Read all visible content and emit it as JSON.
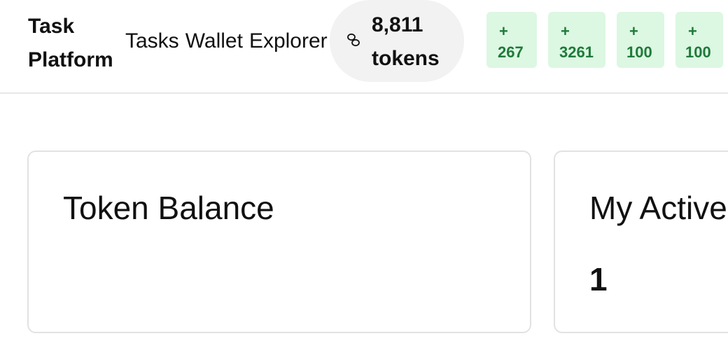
{
  "header": {
    "brand": "Task Platform",
    "nav": [
      "Tasks",
      "Wallet",
      "Explorer"
    ],
    "balance": {
      "amount": "8,811 tokens",
      "icon": "coins-icon"
    },
    "activity_chips": [
      {
        "sign": "+",
        "value": "267"
      },
      {
        "sign": "+",
        "value": "3261"
      },
      {
        "sign": "+",
        "value": "100"
      },
      {
        "sign": "+",
        "value": "100"
      }
    ]
  },
  "cards": [
    {
      "title": "Token Balance",
      "value": ""
    },
    {
      "title": "My Active",
      "value": "1"
    }
  ],
  "colors": {
    "chip_bg": "#dcf7e2",
    "chip_text": "#1f7a3a",
    "pill_bg": "#f2f2f2",
    "border": "#e2e2e2"
  }
}
